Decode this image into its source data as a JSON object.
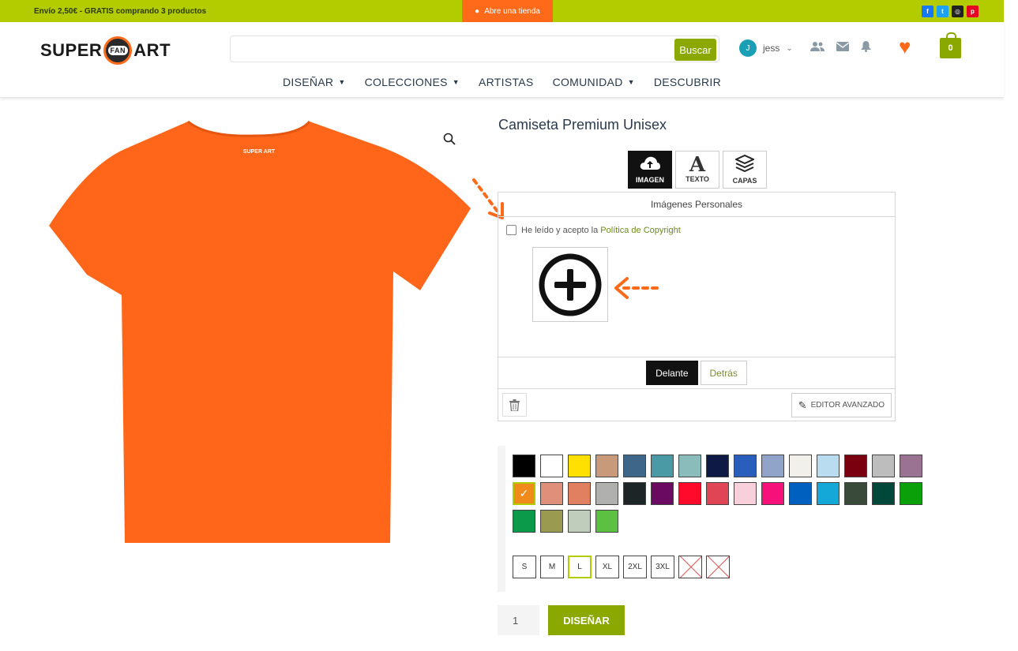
{
  "topbar": {
    "promo": "Envío 2,50€ - GRATIS comprando 3 productos",
    "shop_button": "Abre una tienda",
    "socials": [
      {
        "icon": "facebook-icon",
        "glyph": "f",
        "color": "#1877f2"
      },
      {
        "icon": "twitter-icon",
        "glyph": "t",
        "color": "#1da1f2"
      },
      {
        "icon": "instagram-icon",
        "glyph": "◎",
        "color": "#222222"
      },
      {
        "icon": "pinterest-icon",
        "glyph": "p",
        "color": "#e60023"
      }
    ]
  },
  "header": {
    "logo_left": "SUPER",
    "logo_badge": "FAN",
    "logo_right": "ART",
    "search_placeholder": "",
    "search_button": "Buscar",
    "user_initial": "J",
    "user_name": "jess",
    "cart_count": "0"
  },
  "nav": [
    {
      "label": "DISEÑAR",
      "has_dropdown": true
    },
    {
      "label": "COLECCIONES",
      "has_dropdown": true
    },
    {
      "label": "ARTISTAS",
      "has_dropdown": false
    },
    {
      "label": "COMUNIDAD",
      "has_dropdown": true
    },
    {
      "label": "DESCUBRIR",
      "has_dropdown": false
    }
  ],
  "product": {
    "title": "Camiseta Premium Unisex",
    "shirt_color": "#ff6619",
    "shirt_print": "SUPER ART"
  },
  "tools": [
    {
      "label": "IMAGEN",
      "icon": "cloud-upload-icon",
      "active": true
    },
    {
      "label": "TEXTO",
      "icon": "text-icon",
      "active": false
    },
    {
      "label": "CAPAS",
      "icon": "layers-icon",
      "active": false
    }
  ],
  "panel": {
    "heading": "Imágenes Personales",
    "agree_text": "He leído y acepto la ",
    "agree_link": "Política de Copyright",
    "side_front": "Delante",
    "side_back": "Detrás",
    "advanced_editor": "EDITOR AVANZADO"
  },
  "colors": [
    "#000000",
    "#ffffff",
    "#ffe000",
    "#c99a7a",
    "#3d6688",
    "#4a9aa5",
    "#8bbcbc",
    "#0e1a45",
    "#2a5ebc",
    "#8fa4c8",
    "#f2f0ea",
    "#b9dcf0",
    "#7a0010",
    "#bdbdbd",
    "#9a7292",
    "#f08a1a",
    "#e0907a",
    "#e08060",
    "#b0b0ae",
    "#1d2526",
    "#6a0a60",
    "#ff0a2a",
    "#e04555",
    "#f8d0dc",
    "#f5107a",
    "#0060c0",
    "#14a8d8",
    "#3a4a3a",
    "#00483a",
    "#0aa00a",
    "#0a9a4a",
    "#9a9a50",
    "#c0ccbc",
    "#5cc040"
  ],
  "selected_color_index": 15,
  "sizes": [
    {
      "label": "S",
      "state": "available"
    },
    {
      "label": "M",
      "state": "available"
    },
    {
      "label": "L",
      "state": "selected"
    },
    {
      "label": "XL",
      "state": "available"
    },
    {
      "label": "2XL",
      "state": "available"
    },
    {
      "label": "3XL",
      "state": "available"
    },
    {
      "label": "",
      "state": "unavailable"
    },
    {
      "label": "",
      "state": "unavailable"
    }
  ],
  "quantity": "1",
  "design_button": "DISEÑAR",
  "accent_color": "#8aa800",
  "orange_color": "#ff6a1a"
}
